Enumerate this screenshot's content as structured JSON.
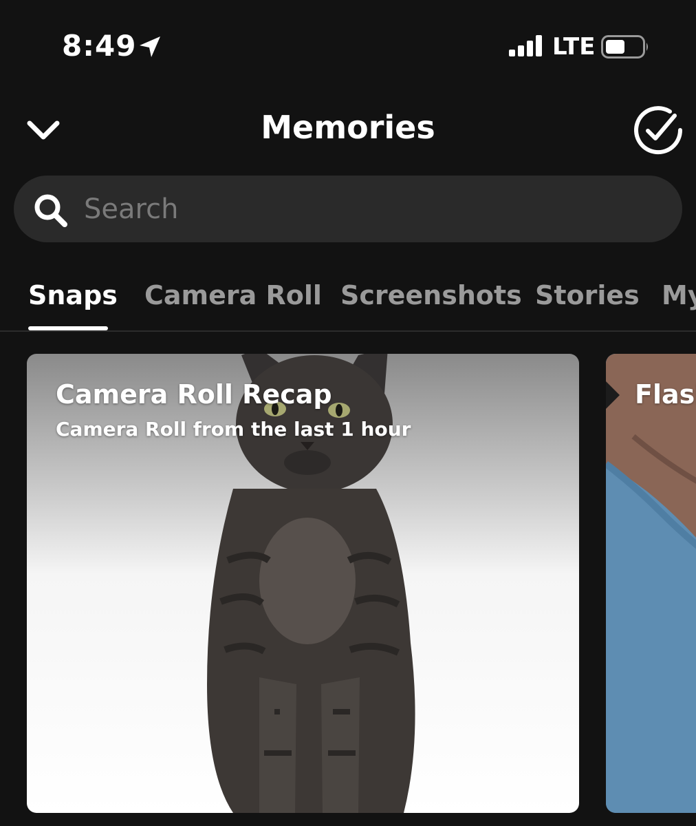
{
  "status_bar": {
    "time": "8:49",
    "network": "LTE",
    "icons": [
      "location-arrow-icon",
      "cellular-signal-icon",
      "battery-icon"
    ]
  },
  "header": {
    "title": "Memories",
    "left_icon": "chevron-down-icon",
    "right_icon": "check-circle-icon"
  },
  "search": {
    "placeholder": "Search",
    "value": ""
  },
  "tabs": [
    {
      "label": "Snaps",
      "active": true
    },
    {
      "label": "Camera Roll",
      "active": false
    },
    {
      "label": "Screenshots",
      "active": false
    },
    {
      "label": "Stories",
      "active": false
    },
    {
      "label": "My",
      "active": false
    }
  ],
  "cards": [
    {
      "title": "Camera Roll Recap",
      "subtitle": "Camera Roll from the last 1 hour",
      "image": "cat-photo"
    },
    {
      "title": "Flash",
      "image": "person-photo"
    }
  ],
  "colors": {
    "background": "#121212",
    "search_background": "#2a2a2a",
    "tab_active": "#ffffff",
    "tab_inactive": "#9a9a9a"
  }
}
